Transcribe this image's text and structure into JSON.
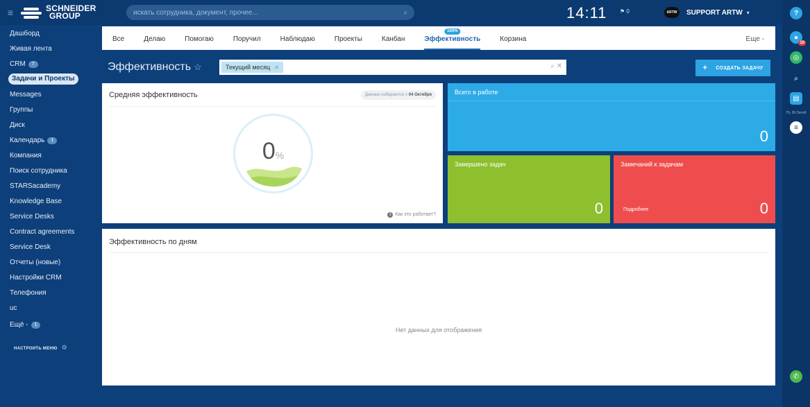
{
  "header": {
    "logo_line1": "SCHNEIDER",
    "logo_line2": "GROUP",
    "search_placeholder": "искать сотрудника, документ, прочее...",
    "clock": "14:11",
    "flag_count": "0",
    "user_avatar_text": "ARTW",
    "user_name": "SUPPORT ARTW"
  },
  "sidebar": {
    "items": [
      {
        "label": "Дашборд"
      },
      {
        "label": "Живая лента"
      },
      {
        "label": "CRM",
        "counter": "7"
      },
      {
        "label": "Задачи и Проекты",
        "active": true
      },
      {
        "label": "Messages"
      },
      {
        "label": "Группы"
      },
      {
        "label": "Диск"
      },
      {
        "label": "Календарь",
        "counter": "1"
      },
      {
        "label": "Компания"
      },
      {
        "label": "Поиск сотрудника"
      },
      {
        "label": "STARSacademy"
      },
      {
        "label": "Knowledge Base"
      },
      {
        "label": "Service Desks"
      },
      {
        "label": "Contract agreements"
      },
      {
        "label": "Service Desk"
      },
      {
        "label": "Отчеты (новые)"
      },
      {
        "label": "Настройки CRM"
      },
      {
        "label": "Телефония"
      },
      {
        "label": "uc"
      },
      {
        "label": "Ещё -",
        "counter": "1"
      }
    ],
    "configure_label": "НАСТРОИТЬ МЕНЮ"
  },
  "tabs": {
    "items": [
      {
        "label": "Все"
      },
      {
        "label": "Делаю"
      },
      {
        "label": "Помогаю"
      },
      {
        "label": "Поручил"
      },
      {
        "label": "Наблюдаю"
      },
      {
        "label": "Проекты"
      },
      {
        "label": "Канбан"
      },
      {
        "label": "Эффективность",
        "active": true,
        "badge": "100%"
      },
      {
        "label": "Корзина"
      }
    ],
    "more_label": "Еще -"
  },
  "toolbar": {
    "page_title": "Эффективность",
    "filter_chip": "Текущий месяц",
    "create_label": "СОЗДАТЬ ЗАДАЧУ"
  },
  "efficiency": {
    "title": "Средняя эффективность",
    "collect_prefix": "Данные собираются с",
    "collect_date": "04 Октября",
    "value": "0",
    "unit": "%",
    "how_link": "Как это работает?"
  },
  "tiles": {
    "in_work": {
      "label": "Всего в работе",
      "value": "0"
    },
    "completed": {
      "label": "Завершено задач",
      "value": "0"
    },
    "remarks": {
      "label": "Замечаний к задачам",
      "value": "0",
      "link": "Подробнее"
    }
  },
  "days": {
    "title": "Эффективность по дням",
    "empty_text": "Нет данных для отображения"
  },
  "rightbar": {
    "help": "?",
    "notifications_badge": "10",
    "date_text": "Пт, 26 Октяб"
  },
  "colors": {
    "sidebar_bg": "#0d3f7a",
    "accent_blue": "#2dabe7",
    "tile_green": "#8dbf2f",
    "tile_red": "#ef4d4d",
    "active_tab": "#2067b0"
  }
}
